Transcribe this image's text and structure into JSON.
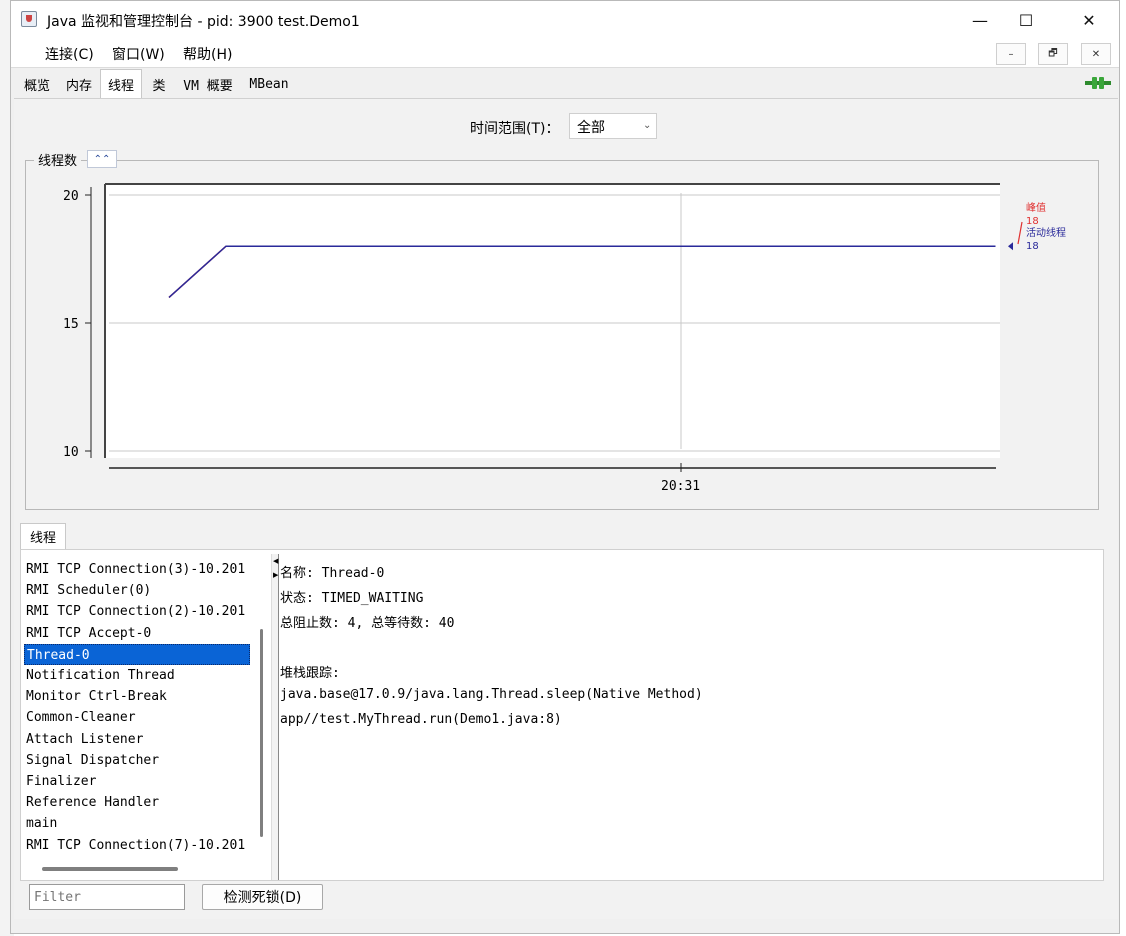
{
  "window": {
    "title": "Java 监视和管理控制台 - pid: 3900 test.Demo1",
    "minimize": "—",
    "maximize": "☐",
    "close": "✕"
  },
  "menu": {
    "items": [
      "连接(C)",
      "窗口(W)",
      "帮助(H)"
    ],
    "inner_buttons": [
      "–",
      "🗗",
      "✕"
    ]
  },
  "tabs": [
    {
      "label": "概览",
      "active": false
    },
    {
      "label": "内存",
      "active": false
    },
    {
      "label": "线程",
      "active": true
    },
    {
      "label": "类",
      "active": false
    },
    {
      "label": "VM 概要",
      "active": false
    },
    {
      "label": "MBean",
      "active": false
    }
  ],
  "time_range": {
    "label": "时间范围(T)：",
    "value": "全部"
  },
  "chart_panel": {
    "title": "线程数",
    "collapse_icon": "double-chevron-up-icon"
  },
  "chart_data": {
    "type": "line",
    "title": "线程数",
    "ylim": [
      10,
      20
    ],
    "yticks": [
      {
        "v": 20,
        "label": "20"
      },
      {
        "v": 15,
        "label": "15"
      },
      {
        "v": 10,
        "label": "10"
      }
    ],
    "xtick_label": "20:31",
    "series": [
      {
        "name": "峰值",
        "color": "#e03030",
        "points": [
          [
            0,
            16
          ],
          [
            1,
            18
          ],
          [
            14.5,
            18
          ]
        ],
        "value_label": "18"
      },
      {
        "name": "活动线程",
        "color": "#2a2a9a",
        "points": [
          [
            0,
            16
          ],
          [
            1,
            18
          ],
          [
            14.5,
            18
          ]
        ],
        "value_label": "18"
      }
    ]
  },
  "colors": {
    "peak": "#e03030",
    "live": "#2a2a9a",
    "selection": "#0a64d6"
  },
  "lower_tab": "线程",
  "threads": [
    {
      "name": "RMI TCP Connection(3)-10.201",
      "selected": false
    },
    {
      "name": "RMI Scheduler(0)",
      "selected": false
    },
    {
      "name": "RMI TCP Connection(2)-10.201",
      "selected": false
    },
    {
      "name": "RMI TCP Accept-0",
      "selected": false
    },
    {
      "name": "Thread-0",
      "selected": true
    },
    {
      "name": "Notification Thread",
      "selected": false
    },
    {
      "name": "Monitor Ctrl-Break",
      "selected": false
    },
    {
      "name": "Common-Cleaner",
      "selected": false
    },
    {
      "name": "Attach Listener",
      "selected": false
    },
    {
      "name": "Signal Dispatcher",
      "selected": false
    },
    {
      "name": "Finalizer",
      "selected": false
    },
    {
      "name": "Reference Handler",
      "selected": false
    },
    {
      "name": "main",
      "selected": false
    },
    {
      "name": "RMI TCP Connection(7)-10.201",
      "selected": false
    }
  ],
  "detail": {
    "name": "名称: Thread-0",
    "state": "状态: TIMED_WAITING",
    "counts": "总阻止数: 4, 总等待数: 40",
    "stack_title": "堆栈跟踪:",
    "stack": [
      "java.base@17.0.9/java.lang.Thread.sleep(Native Method)",
      "app//test.MyThread.run(Demo1.java:8)"
    ]
  },
  "filter": {
    "placeholder": "Filter"
  },
  "deadlock_button": "检测死锁(D)",
  "connection_icon": "connection-plug-icon"
}
